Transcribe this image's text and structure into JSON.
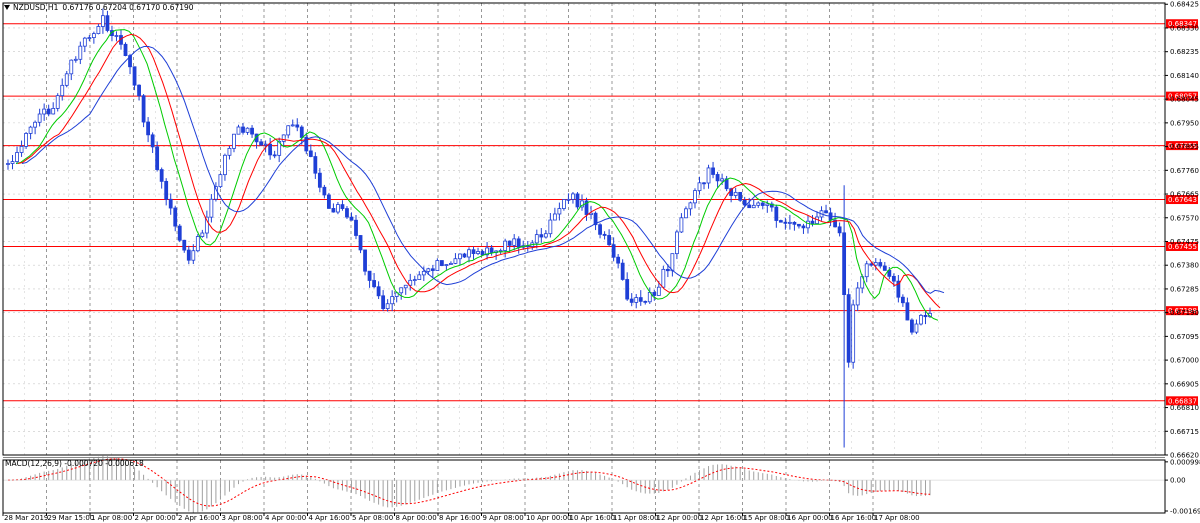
{
  "chart_data": {
    "type": "candlestick",
    "symbol": "NZDUSD,H1",
    "ohlc_text": "0.67176 0.67204 0.67170 0.67190",
    "ylim": [
      0.6662,
      0.6843
    ],
    "price_ticks": [
      "0.68425",
      "0.68330",
      "0.68235",
      "0.68140",
      "0.68045",
      "0.67950",
      "0.67855",
      "0.67760",
      "0.67665",
      "0.67570",
      "0.67475",
      "0.67380",
      "0.67285",
      "0.67190",
      "0.67095",
      "0.67000",
      "0.66905",
      "0.66810",
      "0.66715",
      "0.66620"
    ],
    "horizontal_levels": [
      {
        "value": 0.68347,
        "label": "0.68347"
      },
      {
        "value": 0.68057,
        "label": "0.68057"
      },
      {
        "value": 0.67859,
        "label": "0.67859"
      },
      {
        "value": 0.67643,
        "label": "0.67643"
      },
      {
        "value": 0.67455,
        "label": "0.67455"
      },
      {
        "value": 0.67198,
        "label": "0.67198"
      },
      {
        "value": 0.66837,
        "label": "0.66837"
      }
    ],
    "time_labels": [
      "28 Mar 2019",
      "29 Mar 15:00",
      "1 Apr 08:00",
      "2 Apr 00:00",
      "2 Apr 16:00",
      "3 Apr 08:00",
      "4 Apr 00:00",
      "4 Apr 16:00",
      "5 Apr 08:00",
      "8 Apr 00:00",
      "8 Apr 16:00",
      "9 Apr 08:00",
      "10 Apr 00:00",
      "10 Apr 16:00",
      "11 Apr 08:00",
      "12 Apr 00:00",
      "12 Apr 16:00",
      "15 Apr 08:00",
      "16 Apr 00:00",
      "16 Apr 16:00",
      "17 Apr 08:00"
    ],
    "close_path": [
      [
        0,
        0.6778
      ],
      [
        5,
        0.6792
      ],
      [
        10,
        0.6803
      ],
      [
        14,
        0.6818
      ],
      [
        18,
        0.683
      ],
      [
        21,
        0.6836
      ],
      [
        24,
        0.6829
      ],
      [
        28,
        0.6812
      ],
      [
        31,
        0.679
      ],
      [
        34,
        0.6772
      ],
      [
        37,
        0.6754
      ],
      [
        40,
        0.6742
      ],
      [
        43,
        0.6752
      ],
      [
        46,
        0.677
      ],
      [
        50,
        0.6792
      ],
      [
        53,
        0.6791
      ],
      [
        56,
        0.6787
      ],
      [
        59,
        0.6781
      ],
      [
        62,
        0.6796
      ],
      [
        65,
        0.679
      ],
      [
        68,
        0.6775
      ],
      [
        71,
        0.6762
      ],
      [
        74,
        0.676
      ],
      [
        77,
        0.6752
      ],
      [
        80,
        0.673
      ],
      [
        83,
        0.6722
      ],
      [
        86,
        0.6727
      ],
      [
        89,
        0.673
      ],
      [
        92,
        0.6734
      ],
      [
        95,
        0.6738
      ],
      [
        98,
        0.674
      ],
      [
        101,
        0.6742
      ],
      [
        104,
        0.6743
      ],
      [
        107,
        0.6745
      ],
      [
        110,
        0.6746
      ],
      [
        113,
        0.6747
      ],
      [
        116,
        0.6746
      ],
      [
        119,
        0.6752
      ],
      [
        122,
        0.6762
      ],
      [
        125,
        0.6765
      ],
      [
        128,
        0.676
      ],
      [
        131,
        0.6752
      ],
      [
        134,
        0.6743
      ],
      [
        137,
        0.6725
      ],
      [
        140,
        0.6723
      ],
      [
        143,
        0.6728
      ],
      [
        146,
        0.6738
      ],
      [
        149,
        0.6755
      ],
      [
        152,
        0.6768
      ],
      [
        155,
        0.6775
      ],
      [
        158,
        0.6771
      ],
      [
        161,
        0.6765
      ],
      [
        164,
        0.6763
      ],
      [
        167,
        0.6762
      ],
      [
        170,
        0.6758
      ],
      [
        173,
        0.6753
      ],
      [
        176,
        0.6754
      ],
      [
        179,
        0.6758
      ],
      [
        182,
        0.6757
      ],
      [
        184,
        0.675
      ],
      [
        185,
        0.6726
      ],
      [
        186,
        0.67
      ],
      [
        187,
        0.672
      ],
      [
        189,
        0.6735
      ],
      [
        192,
        0.674
      ],
      [
        195,
        0.6734
      ],
      [
        198,
        0.6722
      ],
      [
        200,
        0.6713
      ],
      [
        202,
        0.6719
      ]
    ],
    "macd": {
      "label": "MACD(12,26,9) -0.000720 -0.000618",
      "ylim": [
        -0.00169,
        0.00099
      ],
      "ticks": [
        "0.000998",
        "0.00",
        "-0.00169"
      ]
    },
    "colors": {
      "line": "#ff0000",
      "candle": "#1f3fd6",
      "ma_fast": "#00cc00",
      "ma_mid": "#ff0000",
      "ma_slow": "#1f3fd6",
      "grid": "#c8c8c8"
    }
  }
}
